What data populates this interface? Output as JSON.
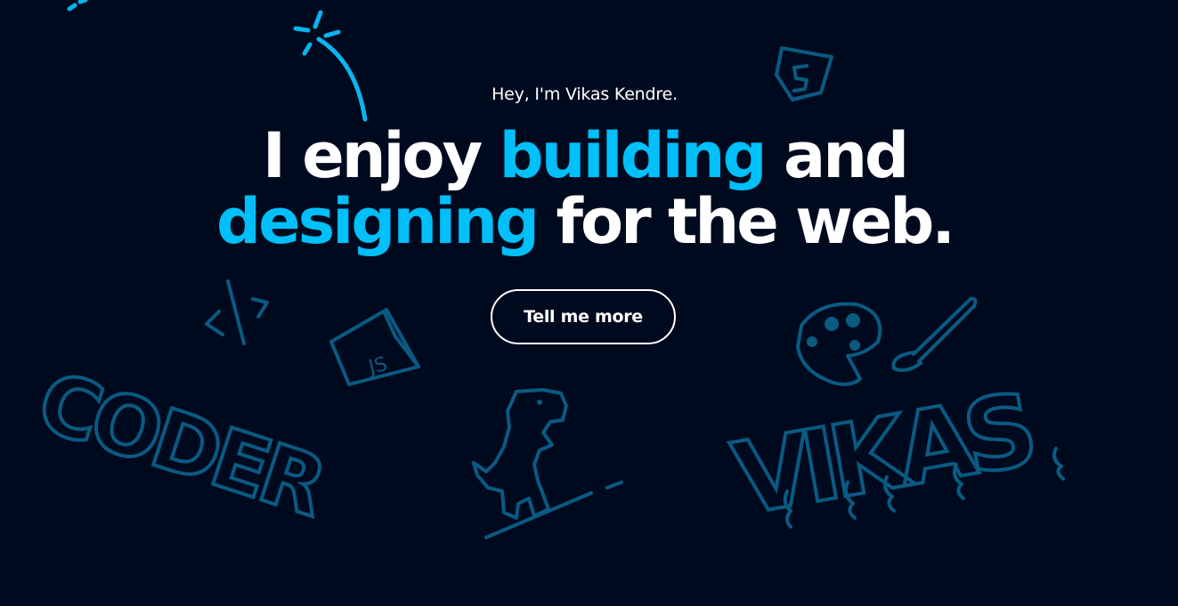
{
  "hero": {
    "greeting": "Hey, I'm Vikas Kendre.",
    "headline_line1": {
      "part1": "I enjoy ",
      "accent": "building",
      "part2": " and"
    },
    "headline_line2": {
      "accent": "designing",
      "part2": " for the web."
    },
    "cta_label": "Tell me more"
  },
  "doodles": {
    "code_tag_icon_text": "</>",
    "js_icon_text": "JS",
    "html5_icon_text": "5",
    "coder_text": "CODER",
    "vikas_text": "VIKAS"
  },
  "colors": {
    "background": "#000a1e",
    "accent": "#00bff9",
    "text": "#ffffff",
    "doodle": "#0a5a82"
  }
}
